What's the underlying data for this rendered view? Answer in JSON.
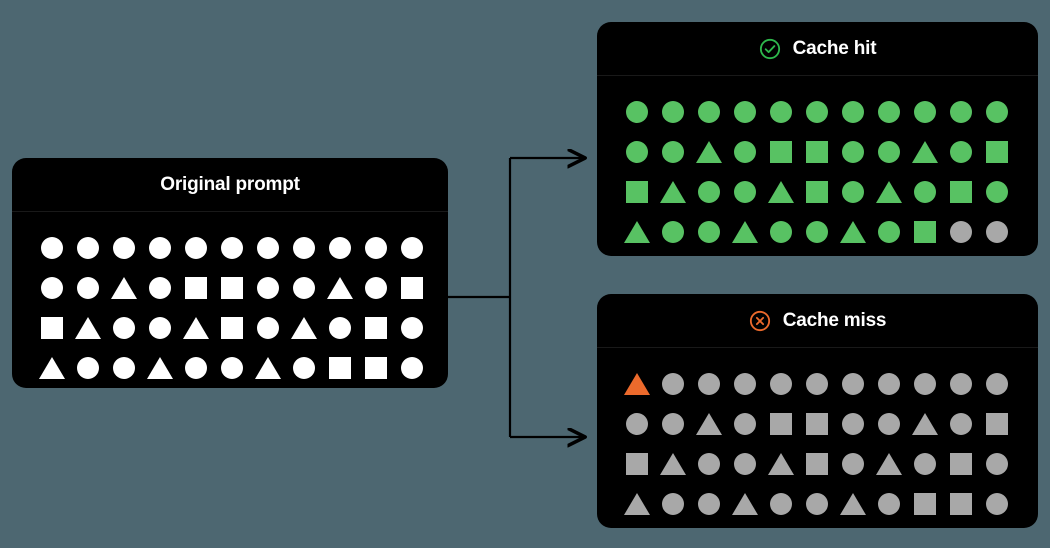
{
  "colors": {
    "background": "#4d6771",
    "panel_bg": "#000000",
    "white_shape": "#ffffff",
    "green_shape": "#58c263",
    "gray_shape": "#a8a8a8",
    "orange_shape": "#ec6a2c",
    "title_text": "#ffffff",
    "connector": "#000000"
  },
  "panels": {
    "original": {
      "title": "Original prompt",
      "icon": null,
      "rows": [
        [
          {
            "shape": "circle",
            "color": "#ffffff"
          },
          {
            "shape": "circle",
            "color": "#ffffff"
          },
          {
            "shape": "circle",
            "color": "#ffffff"
          },
          {
            "shape": "circle",
            "color": "#ffffff"
          },
          {
            "shape": "circle",
            "color": "#ffffff"
          },
          {
            "shape": "circle",
            "color": "#ffffff"
          },
          {
            "shape": "circle",
            "color": "#ffffff"
          },
          {
            "shape": "circle",
            "color": "#ffffff"
          },
          {
            "shape": "circle",
            "color": "#ffffff"
          },
          {
            "shape": "circle",
            "color": "#ffffff"
          },
          {
            "shape": "circle",
            "color": "#ffffff"
          }
        ],
        [
          {
            "shape": "circle",
            "color": "#ffffff"
          },
          {
            "shape": "circle",
            "color": "#ffffff"
          },
          {
            "shape": "triangle",
            "color": "#ffffff"
          },
          {
            "shape": "circle",
            "color": "#ffffff"
          },
          {
            "shape": "square",
            "color": "#ffffff"
          },
          {
            "shape": "square",
            "color": "#ffffff"
          },
          {
            "shape": "circle",
            "color": "#ffffff"
          },
          {
            "shape": "circle",
            "color": "#ffffff"
          },
          {
            "shape": "triangle",
            "color": "#ffffff"
          },
          {
            "shape": "circle",
            "color": "#ffffff"
          },
          {
            "shape": "square",
            "color": "#ffffff"
          }
        ],
        [
          {
            "shape": "square",
            "color": "#ffffff"
          },
          {
            "shape": "triangle",
            "color": "#ffffff"
          },
          {
            "shape": "circle",
            "color": "#ffffff"
          },
          {
            "shape": "circle",
            "color": "#ffffff"
          },
          {
            "shape": "triangle",
            "color": "#ffffff"
          },
          {
            "shape": "square",
            "color": "#ffffff"
          },
          {
            "shape": "circle",
            "color": "#ffffff"
          },
          {
            "shape": "triangle",
            "color": "#ffffff"
          },
          {
            "shape": "circle",
            "color": "#ffffff"
          },
          {
            "shape": "square",
            "color": "#ffffff"
          },
          {
            "shape": "circle",
            "color": "#ffffff"
          }
        ],
        [
          {
            "shape": "triangle",
            "color": "#ffffff"
          },
          {
            "shape": "circle",
            "color": "#ffffff"
          },
          {
            "shape": "circle",
            "color": "#ffffff"
          },
          {
            "shape": "triangle",
            "color": "#ffffff"
          },
          {
            "shape": "circle",
            "color": "#ffffff"
          },
          {
            "shape": "circle",
            "color": "#ffffff"
          },
          {
            "shape": "triangle",
            "color": "#ffffff"
          },
          {
            "shape": "circle",
            "color": "#ffffff"
          },
          {
            "shape": "square",
            "color": "#ffffff"
          },
          {
            "shape": "square",
            "color": "#ffffff"
          },
          {
            "shape": "circle",
            "color": "#ffffff"
          }
        ]
      ]
    },
    "cache_hit": {
      "title": "Cache hit",
      "icon": "check-circle-icon",
      "icon_color": "#2eb84c",
      "rows": [
        [
          {
            "shape": "circle",
            "color": "#58c263"
          },
          {
            "shape": "circle",
            "color": "#58c263"
          },
          {
            "shape": "circle",
            "color": "#58c263"
          },
          {
            "shape": "circle",
            "color": "#58c263"
          },
          {
            "shape": "circle",
            "color": "#58c263"
          },
          {
            "shape": "circle",
            "color": "#58c263"
          },
          {
            "shape": "circle",
            "color": "#58c263"
          },
          {
            "shape": "circle",
            "color": "#58c263"
          },
          {
            "shape": "circle",
            "color": "#58c263"
          },
          {
            "shape": "circle",
            "color": "#58c263"
          },
          {
            "shape": "circle",
            "color": "#58c263"
          }
        ],
        [
          {
            "shape": "circle",
            "color": "#58c263"
          },
          {
            "shape": "circle",
            "color": "#58c263"
          },
          {
            "shape": "triangle",
            "color": "#58c263"
          },
          {
            "shape": "circle",
            "color": "#58c263"
          },
          {
            "shape": "square",
            "color": "#58c263"
          },
          {
            "shape": "square",
            "color": "#58c263"
          },
          {
            "shape": "circle",
            "color": "#58c263"
          },
          {
            "shape": "circle",
            "color": "#58c263"
          },
          {
            "shape": "triangle",
            "color": "#58c263"
          },
          {
            "shape": "circle",
            "color": "#58c263"
          },
          {
            "shape": "square",
            "color": "#58c263"
          }
        ],
        [
          {
            "shape": "square",
            "color": "#58c263"
          },
          {
            "shape": "triangle",
            "color": "#58c263"
          },
          {
            "shape": "circle",
            "color": "#58c263"
          },
          {
            "shape": "circle",
            "color": "#58c263"
          },
          {
            "shape": "triangle",
            "color": "#58c263"
          },
          {
            "shape": "square",
            "color": "#58c263"
          },
          {
            "shape": "circle",
            "color": "#58c263"
          },
          {
            "shape": "triangle",
            "color": "#58c263"
          },
          {
            "shape": "circle",
            "color": "#58c263"
          },
          {
            "shape": "square",
            "color": "#58c263"
          },
          {
            "shape": "circle",
            "color": "#58c263"
          }
        ],
        [
          {
            "shape": "triangle",
            "color": "#58c263"
          },
          {
            "shape": "circle",
            "color": "#58c263"
          },
          {
            "shape": "circle",
            "color": "#58c263"
          },
          {
            "shape": "triangle",
            "color": "#58c263"
          },
          {
            "shape": "circle",
            "color": "#58c263"
          },
          {
            "shape": "circle",
            "color": "#58c263"
          },
          {
            "shape": "triangle",
            "color": "#58c263"
          },
          {
            "shape": "circle",
            "color": "#58c263"
          },
          {
            "shape": "square",
            "color": "#58c263"
          },
          {
            "shape": "circle",
            "color": "#a8a8a8"
          },
          {
            "shape": "circle",
            "color": "#a8a8a8"
          }
        ]
      ]
    },
    "cache_miss": {
      "title": "Cache miss",
      "icon": "x-circle-icon",
      "icon_color": "#ec6a2c",
      "rows": [
        [
          {
            "shape": "triangle",
            "color": "#ec6a2c"
          },
          {
            "shape": "circle",
            "color": "#a8a8a8"
          },
          {
            "shape": "circle",
            "color": "#a8a8a8"
          },
          {
            "shape": "circle",
            "color": "#a8a8a8"
          },
          {
            "shape": "circle",
            "color": "#a8a8a8"
          },
          {
            "shape": "circle",
            "color": "#a8a8a8"
          },
          {
            "shape": "circle",
            "color": "#a8a8a8"
          },
          {
            "shape": "circle",
            "color": "#a8a8a8"
          },
          {
            "shape": "circle",
            "color": "#a8a8a8"
          },
          {
            "shape": "circle",
            "color": "#a8a8a8"
          },
          {
            "shape": "circle",
            "color": "#a8a8a8"
          }
        ],
        [
          {
            "shape": "circle",
            "color": "#a8a8a8"
          },
          {
            "shape": "circle",
            "color": "#a8a8a8"
          },
          {
            "shape": "triangle",
            "color": "#a8a8a8"
          },
          {
            "shape": "circle",
            "color": "#a8a8a8"
          },
          {
            "shape": "square",
            "color": "#a8a8a8"
          },
          {
            "shape": "square",
            "color": "#a8a8a8"
          },
          {
            "shape": "circle",
            "color": "#a8a8a8"
          },
          {
            "shape": "circle",
            "color": "#a8a8a8"
          },
          {
            "shape": "triangle",
            "color": "#a8a8a8"
          },
          {
            "shape": "circle",
            "color": "#a8a8a8"
          },
          {
            "shape": "square",
            "color": "#a8a8a8"
          }
        ],
        [
          {
            "shape": "square",
            "color": "#a8a8a8"
          },
          {
            "shape": "triangle",
            "color": "#a8a8a8"
          },
          {
            "shape": "circle",
            "color": "#a8a8a8"
          },
          {
            "shape": "circle",
            "color": "#a8a8a8"
          },
          {
            "shape": "triangle",
            "color": "#a8a8a8"
          },
          {
            "shape": "square",
            "color": "#a8a8a8"
          },
          {
            "shape": "circle",
            "color": "#a8a8a8"
          },
          {
            "shape": "triangle",
            "color": "#a8a8a8"
          },
          {
            "shape": "circle",
            "color": "#a8a8a8"
          },
          {
            "shape": "square",
            "color": "#a8a8a8"
          },
          {
            "shape": "circle",
            "color": "#a8a8a8"
          }
        ],
        [
          {
            "shape": "triangle",
            "color": "#a8a8a8"
          },
          {
            "shape": "circle",
            "color": "#a8a8a8"
          },
          {
            "shape": "circle",
            "color": "#a8a8a8"
          },
          {
            "shape": "triangle",
            "color": "#a8a8a8"
          },
          {
            "shape": "circle",
            "color": "#a8a8a8"
          },
          {
            "shape": "circle",
            "color": "#a8a8a8"
          },
          {
            "shape": "triangle",
            "color": "#a8a8a8"
          },
          {
            "shape": "circle",
            "color": "#a8a8a8"
          },
          {
            "shape": "square",
            "color": "#a8a8a8"
          },
          {
            "shape": "square",
            "color": "#a8a8a8"
          },
          {
            "shape": "circle",
            "color": "#a8a8a8"
          }
        ]
      ]
    }
  },
  "connectors": [
    {
      "name": "arrow-to-cache-hit"
    },
    {
      "name": "arrow-to-cache-miss"
    }
  ]
}
